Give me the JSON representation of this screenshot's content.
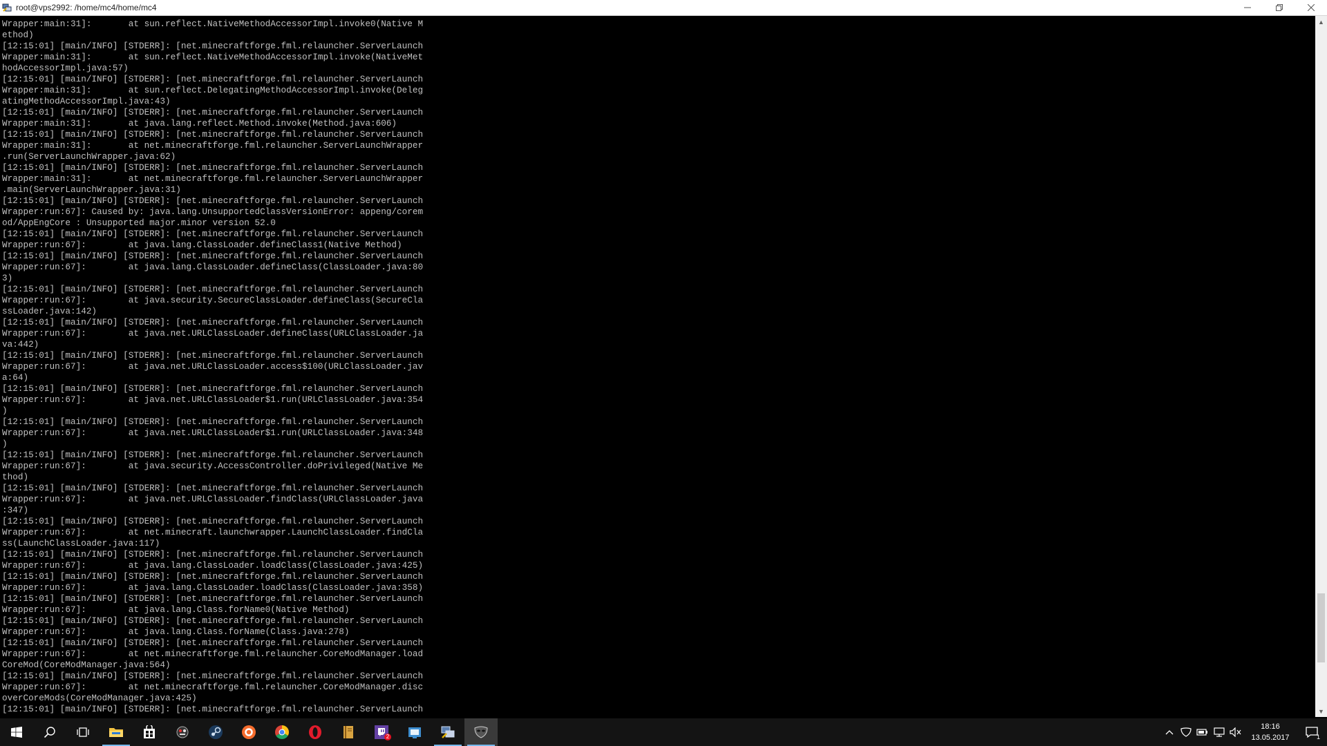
{
  "window": {
    "title": "root@vps2992: /home/mc4/home/mc4",
    "icon": "putty-icon"
  },
  "terminal": {
    "lines": [
      "Wrapper:main:31]:       at sun.reflect.NativeMethodAccessorImpl.invoke0(Native M",
      "ethod)",
      "[12:15:01] [main/INFO] [STDERR]: [net.minecraftforge.fml.relauncher.ServerLaunch",
      "Wrapper:main:31]:       at sun.reflect.NativeMethodAccessorImpl.invoke(NativeMet",
      "hodAccessorImpl.java:57)",
      "[12:15:01] [main/INFO] [STDERR]: [net.minecraftforge.fml.relauncher.ServerLaunch",
      "Wrapper:main:31]:       at sun.reflect.DelegatingMethodAccessorImpl.invoke(Deleg",
      "atingMethodAccessorImpl.java:43)",
      "[12:15:01] [main/INFO] [STDERR]: [net.minecraftforge.fml.relauncher.ServerLaunch",
      "Wrapper:main:31]:       at java.lang.reflect.Method.invoke(Method.java:606)",
      "[12:15:01] [main/INFO] [STDERR]: [net.minecraftforge.fml.relauncher.ServerLaunch",
      "Wrapper:main:31]:       at net.minecraftforge.fml.relauncher.ServerLaunchWrapper",
      ".run(ServerLaunchWrapper.java:62)",
      "[12:15:01] [main/INFO] [STDERR]: [net.minecraftforge.fml.relauncher.ServerLaunch",
      "Wrapper:main:31]:       at net.minecraftforge.fml.relauncher.ServerLaunchWrapper",
      ".main(ServerLaunchWrapper.java:31)",
      "[12:15:01] [main/INFO] [STDERR]: [net.minecraftforge.fml.relauncher.ServerLaunch",
      "Wrapper:run:67]: Caused by: java.lang.UnsupportedClassVersionError: appeng/corem",
      "od/AppEngCore : Unsupported major.minor version 52.0",
      "[12:15:01] [main/INFO] [STDERR]: [net.minecraftforge.fml.relauncher.ServerLaunch",
      "Wrapper:run:67]:        at java.lang.ClassLoader.defineClass1(Native Method)",
      "[12:15:01] [main/INFO] [STDERR]: [net.minecraftforge.fml.relauncher.ServerLaunch",
      "Wrapper:run:67]:        at java.lang.ClassLoader.defineClass(ClassLoader.java:80",
      "3)",
      "[12:15:01] [main/INFO] [STDERR]: [net.minecraftforge.fml.relauncher.ServerLaunch",
      "Wrapper:run:67]:        at java.security.SecureClassLoader.defineClass(SecureCla",
      "ssLoader.java:142)",
      "[12:15:01] [main/INFO] [STDERR]: [net.minecraftforge.fml.relauncher.ServerLaunch",
      "Wrapper:run:67]:        at java.net.URLClassLoader.defineClass(URLClassLoader.ja",
      "va:442)",
      "[12:15:01] [main/INFO] [STDERR]: [net.minecraftforge.fml.relauncher.ServerLaunch",
      "Wrapper:run:67]:        at java.net.URLClassLoader.access$100(URLClassLoader.jav",
      "a:64)",
      "[12:15:01] [main/INFO] [STDERR]: [net.minecraftforge.fml.relauncher.ServerLaunch",
      "Wrapper:run:67]:        at java.net.URLClassLoader$1.run(URLClassLoader.java:354",
      ")",
      "[12:15:01] [main/INFO] [STDERR]: [net.minecraftforge.fml.relauncher.ServerLaunch",
      "Wrapper:run:67]:        at java.net.URLClassLoader$1.run(URLClassLoader.java:348",
      ")",
      "[12:15:01] [main/INFO] [STDERR]: [net.minecraftforge.fml.relauncher.ServerLaunch",
      "Wrapper:run:67]:        at java.security.AccessController.doPrivileged(Native Me",
      "thod)",
      "[12:15:01] [main/INFO] [STDERR]: [net.minecraftforge.fml.relauncher.ServerLaunch",
      "Wrapper:run:67]:        at java.net.URLClassLoader.findClass(URLClassLoader.java",
      ":347)",
      "[12:15:01] [main/INFO] [STDERR]: [net.minecraftforge.fml.relauncher.ServerLaunch",
      "Wrapper:run:67]:        at net.minecraft.launchwrapper.LaunchClassLoader.findCla",
      "ss(LaunchClassLoader.java:117)",
      "[12:15:01] [main/INFO] [STDERR]: [net.minecraftforge.fml.relauncher.ServerLaunch",
      "Wrapper:run:67]:        at java.lang.ClassLoader.loadClass(ClassLoader.java:425)",
      "[12:15:01] [main/INFO] [STDERR]: [net.minecraftforge.fml.relauncher.ServerLaunch",
      "Wrapper:run:67]:        at java.lang.ClassLoader.loadClass(ClassLoader.java:358)",
      "[12:15:01] [main/INFO] [STDERR]: [net.minecraftforge.fml.relauncher.ServerLaunch",
      "Wrapper:run:67]:        at java.lang.Class.forName0(Native Method)",
      "[12:15:01] [main/INFO] [STDERR]: [net.minecraftforge.fml.relauncher.ServerLaunch",
      "Wrapper:run:67]:        at java.lang.Class.forName(Class.java:278)",
      "[12:15:01] [main/INFO] [STDERR]: [net.minecraftforge.fml.relauncher.ServerLaunch",
      "Wrapper:run:67]:        at net.minecraftforge.fml.relauncher.CoreModManager.load",
      "CoreMod(CoreModManager.java:564)",
      "[12:15:01] [main/INFO] [STDERR]: [net.minecraftforge.fml.relauncher.ServerLaunch",
      "Wrapper:run:67]:        at net.minecraftforge.fml.relauncher.CoreModManager.disc",
      "overCoreMods(CoreModManager.java:425)",
      "[12:15:01] [main/INFO] [STDERR]: [net.minecraftforge.fml.relauncher.ServerLaunch"
    ],
    "text_color": "#c0c0c0",
    "background": "#000000"
  },
  "scrollbar": {
    "position_fraction": 0.93
  },
  "taskbar": {
    "apps": [
      {
        "name": "start-button",
        "icon": "windows-logo-icon"
      },
      {
        "name": "search-button",
        "icon": "search-icon"
      },
      {
        "name": "task-view-button",
        "icon": "task-view-icon"
      },
      {
        "name": "file-explorer",
        "icon": "folder-icon",
        "state": "open"
      },
      {
        "name": "store",
        "icon": "store-icon"
      },
      {
        "name": "game-app",
        "icon": "gamepad-icon"
      },
      {
        "name": "steam",
        "icon": "steam-icon"
      },
      {
        "name": "origin",
        "icon": "origin-icon"
      },
      {
        "name": "chrome",
        "icon": "chrome-icon"
      },
      {
        "name": "opera",
        "icon": "opera-icon"
      },
      {
        "name": "minecraft-launcher",
        "icon": "book-icon"
      },
      {
        "name": "twitch",
        "icon": "twitch-icon",
        "badge": "2"
      },
      {
        "name": "bluestacks",
        "icon": "grid-app-icon"
      },
      {
        "name": "putty",
        "icon": "putty-icon",
        "state": "active"
      },
      {
        "name": "discord-like",
        "icon": "mask-icon",
        "state": "highlight"
      }
    ],
    "tray": {
      "clock_time": "18:16",
      "clock_date": "13.05.2017",
      "notification_count": "1"
    }
  }
}
